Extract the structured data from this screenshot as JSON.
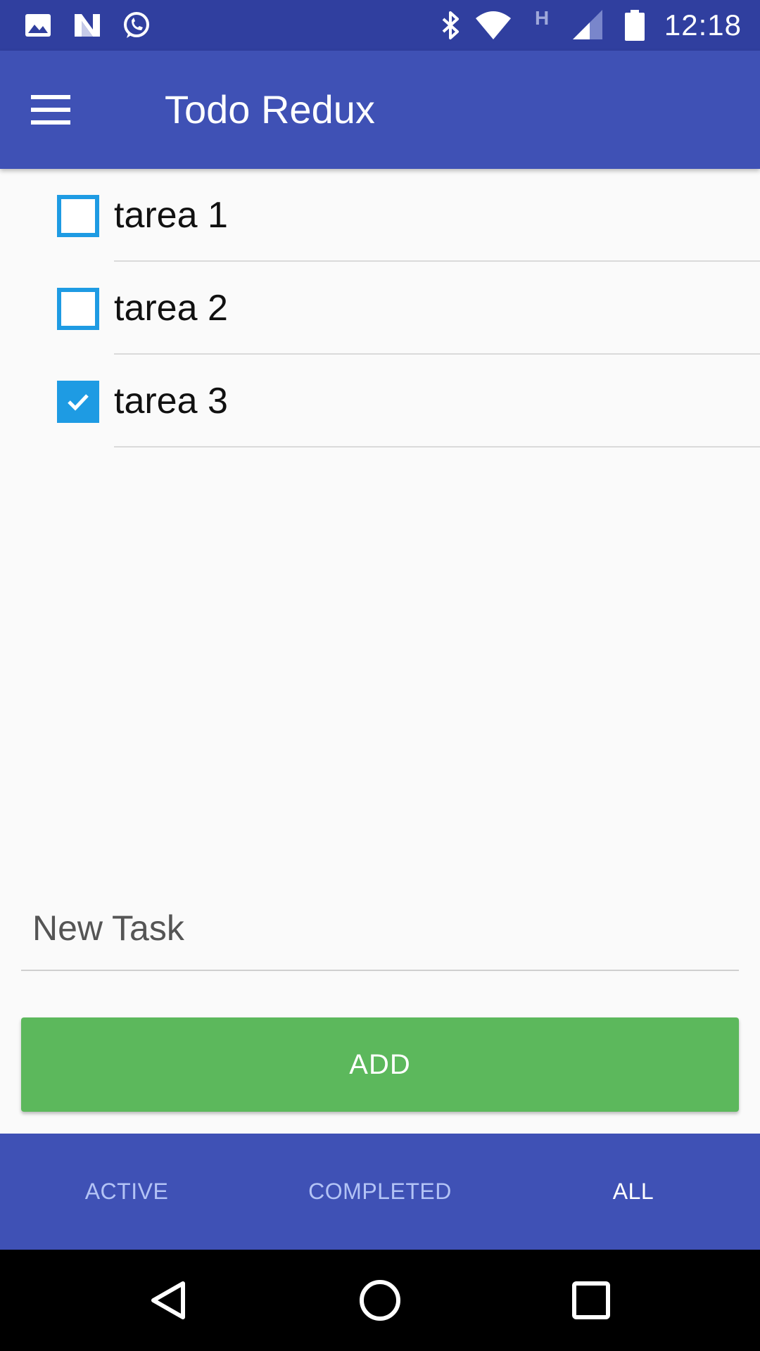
{
  "status_bar": {
    "time": "12:18",
    "left_icons": [
      "image-icon",
      "n-icon",
      "whatsapp-icon"
    ],
    "right_icons": [
      "bluetooth-icon",
      "wifi-icon",
      "h-network-icon",
      "signal-icon",
      "battery-icon"
    ],
    "network_type": "H"
  },
  "app_bar": {
    "title": "Todo Redux",
    "menu_icon": "menu-icon",
    "background_color": "#3F51B5"
  },
  "todos": [
    {
      "text": "tarea 1",
      "completed": false
    },
    {
      "text": "tarea 2",
      "completed": false
    },
    {
      "text": "tarea 3",
      "completed": true
    }
  ],
  "new_task": {
    "placeholder": "New Task",
    "value": ""
  },
  "add_button": {
    "label": "ADD",
    "color": "#5CB85C"
  },
  "tabs": [
    {
      "label": "ACTIVE",
      "selected": false
    },
    {
      "label": "COMPLETED",
      "selected": false
    },
    {
      "label": "ALL",
      "selected": true
    }
  ],
  "nav_bar": {
    "buttons": [
      "back-icon",
      "home-icon",
      "recents-icon"
    ]
  },
  "colors": {
    "checkbox": "#1E9BE3",
    "status_bar": "#303F9F"
  }
}
